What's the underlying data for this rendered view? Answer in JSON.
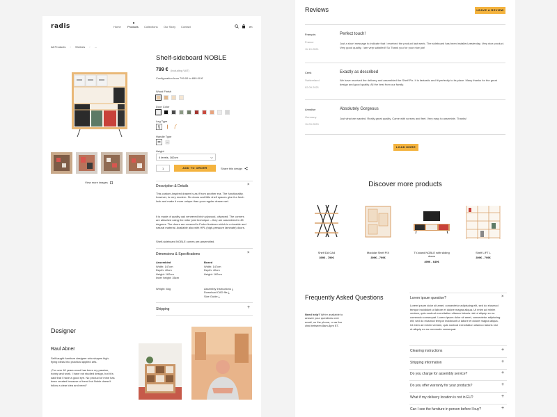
{
  "logo": "radis",
  "nav": [
    "Home",
    "Products",
    "Collections",
    "Our Story",
    "Contact"
  ],
  "header_lang": "en",
  "breadcrumb": [
    "All Products",
    "Shelves",
    "..."
  ],
  "product": {
    "title": "Shelf-sideboard NOBLE",
    "price": "799 €",
    "price_note": "(including VAT)",
    "config_range": "Configuration from 799.00 to 899.00 €",
    "wood_label": "Wood Finish",
    "door_label": "Door Color",
    "leg_label": "Leg Type",
    "handle_label": "Handle Type",
    "height_label": "Height",
    "height_value": "4 levels, 162cm",
    "quantity": "1",
    "add_to_order": "ADD TO ORDER",
    "share": "Share this design",
    "view_more": "View more images"
  },
  "wood_swatches": [
    "#e8c9a6",
    "#e2b98f",
    "#f1dcc2",
    "#f5e6d3"
  ],
  "door_swatches": [
    "#f3f3f3",
    "#111111",
    "#4a4a4a",
    "#8d9b86",
    "#6f7d68",
    "#a3342f",
    "#c94a3f",
    "#e7a47f",
    "#ececec",
    "#d6d6d6"
  ],
  "description": {
    "heading": "Description & Details",
    "p1": "This custom-inspired drawer is as if from another era. The functionality, however, is very modern. Six doors and little shelf spaces give it a fresh look and make it more unique than your regular drawer set.",
    "p2": "It is made of quality oak veneered birch plywood, oilwaxed. The corners are attached using the miter joint technique – they are assembled in 45 degrees. The doors are covered in Forbo linoleum which is a durable and natural material. Available also with HPL (high-pressure laminate) doors.",
    "p3": "Shelf-sideboard NOBLE comes pre-assembled."
  },
  "dimensions": {
    "heading": "Dimensions & Specifications",
    "assembled_label": "Assembled",
    "assembled": [
      "Width: 147cm",
      "Depth: 40cm",
      "Height: 162cm",
      "Inner height: 35cm"
    ],
    "boxed_label": "Boxed",
    "boxed": [
      "Width: 147cm",
      "Depth: 40cm",
      "Height: 162cm"
    ],
    "weight": "Weight: 6kg",
    "links": [
      "Assembly Instructions",
      "Download CAD file",
      "Size Guide"
    ]
  },
  "shipping": "Shipping",
  "designer": {
    "heading": "Designer",
    "name": "Raul Abner",
    "bio": "Self-taught furniture designer who shapes high-flying ideas into practical applied arts.",
    "quote": "„For over 40 years wood has been my passion, hobby and work. I have not studied design, but it is said that I have a good eye. No product of mine has been created because of trend but Noble doesn't follow a clear idea and need.“"
  },
  "reviews": {
    "heading": "Reviews",
    "leave_button": "LEAVE A REVIEW",
    "items": [
      {
        "name": "François",
        "country": "France",
        "date": "11.10.2021",
        "title": "Perfect touch!",
        "body": "Just a short message to indicate that I received the product last week. The sideboard has been installed yesterday. Very nice product. Very good quality. I am very satisfied! So Thank you for your nice job!"
      },
      {
        "name": "Cenk",
        "country": "Switzerland",
        "date": "02.09.2021",
        "title": "Exactly as described",
        "body": "We have received the delivery and assembled the Shelf Pix. It is fantastic and fit perfectly to its place. Many thanks for the great design and good quality. All the best from our family."
      },
      {
        "name": "Annalise",
        "country": "Germany",
        "date": "11.03.2020",
        "title": "Absolutely Gorgeous",
        "body": "Just what we wanted. Really great quality. Came with screws and feet. Very easy to assemble. Thanks!"
      }
    ],
    "load_more": "LOAD MORE"
  },
  "discover": {
    "heading": "Discover more products",
    "products": [
      {
        "name": "Shelf DA GA4",
        "price": "399€ - 799€"
      },
      {
        "name": "Modular Shelf PIX",
        "price": "399€ - 799€"
      },
      {
        "name": "TV-stand NOBLE with sliding doors",
        "price": "499€ - 649€"
      },
      {
        "name": "Shelf LIFT L",
        "price": "399€ - 799€"
      }
    ]
  },
  "faq": {
    "heading": "Frequently Asked Questions",
    "help_title": "Need help?",
    "help_text": "We're available to answer your questions over email, on the phone, or as live chat between 8am-8pm ET.",
    "open_question": "Lorem ipsum question?",
    "open_answer": "Lorem ipsum dolor sit amet, consectetur adipiscing elit, sed do eiusmod tempor incididunt ut labore et dolore magna aliqua. Ut enim ad minim veniam, quis nostrud exercitation ullamco laboris nisi ut aliquip ex ea commodo consequat. Lorem ipsum dolor sit amet, consectetur adipiscing elit, sed do eiusmod tempor incididunt ut labore et dolore magna aliqua. Ut enim ad minim veniam, quis nostrud exercitation ullamco laboris nisi ut aliquip ex ea commodo consequat.",
    "questions": [
      "Cleaning instructions",
      "Shipping information",
      "Do you charge for assembly service?",
      "Do you offer warranty for your products?",
      "What if my delivery location is not in EU?",
      "Can I see the furniture in person before I buy?"
    ]
  }
}
